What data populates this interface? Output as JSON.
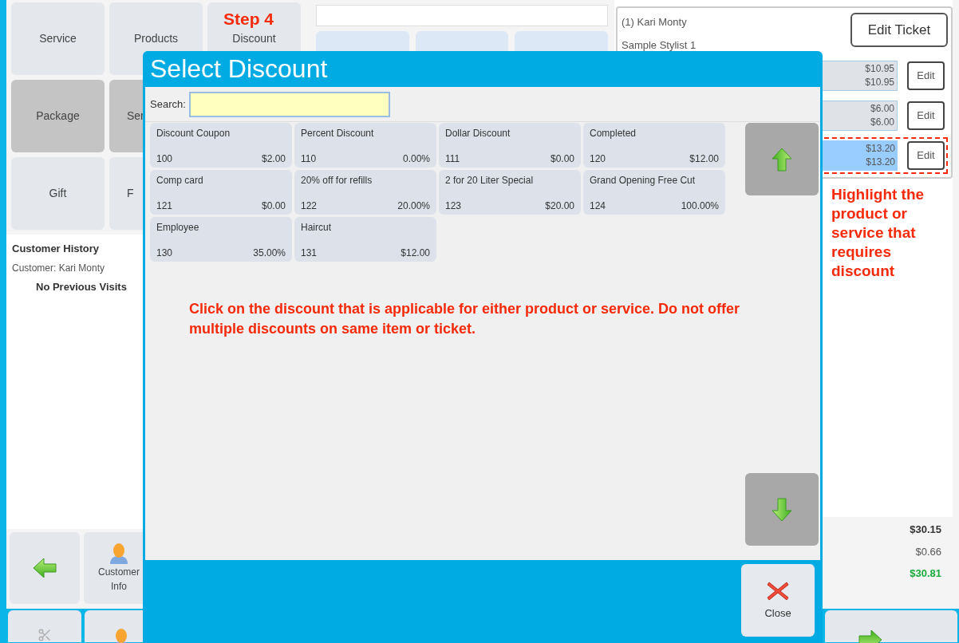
{
  "nav_tiles": [
    {
      "label": "Service",
      "selected": false
    },
    {
      "label": "Products",
      "selected": false
    },
    {
      "label": "Discount",
      "selected": false,
      "annotation": "Step 4"
    },
    {
      "label": "Package",
      "selected": true
    },
    {
      "label": "Ser",
      "selected": true
    },
    {
      "label": "Gift",
      "selected": false
    },
    {
      "label": "F",
      "selected": false
    }
  ],
  "customer_history": {
    "title": "Customer History",
    "customer": "Customer: Kari Monty",
    "visits": "No Previous Visits"
  },
  "customer_info_button": "Customer Info",
  "ticket": {
    "customer": "(1) Kari Monty",
    "stylist": "Sample Stylist 1",
    "edit_ticket": "Edit Ticket",
    "items": [
      {
        "price": "$10.95",
        "total": "$10.95",
        "edit": "Edit",
        "selected": false
      },
      {
        "price": "$6.00",
        "total": "$6.00",
        "edit": "Edit",
        "selected": false
      },
      {
        "price": "$13.20",
        "total": "$13.20",
        "edit": "Edit",
        "selected": true
      }
    ]
  },
  "annotation": "Highlight the product or service that requires discount",
  "totals": [
    {
      "kind": "subtotal",
      "value": "$30.15"
    },
    {
      "kind": "tax",
      "value": "$0.66"
    },
    {
      "kind": "total",
      "value": "$30.81"
    }
  ],
  "dialog": {
    "title": "Select Discount",
    "search_label": "Search:",
    "discounts": [
      {
        "name": "Discount Coupon",
        "code": "100",
        "amount": "$2.00"
      },
      {
        "name": "Percent Discount",
        "code": "110",
        "amount": "0.00%"
      },
      {
        "name": "Dollar Discount",
        "code": "111",
        "amount": "$0.00"
      },
      {
        "name": "Completed",
        "code": "120",
        "amount": "$12.00"
      },
      {
        "name": "Comp card",
        "code": "121",
        "amount": "$0.00"
      },
      {
        "name": "20% off for refills",
        "code": "122",
        "amount": "20.00%"
      },
      {
        "name": "2 for 20 Liter Special",
        "code": "123",
        "amount": "$20.00"
      },
      {
        "name": "Grand Opening Free Cut",
        "code": "124",
        "amount": "100.00%"
      },
      {
        "name": "Employee",
        "code": "130",
        "amount": "35.00%"
      },
      {
        "name": "Haircut",
        "code": "131",
        "amount": "$12.00"
      }
    ],
    "instruction": "Click on the discount that is applicable for either product or service.  Do not offer multiple discounts on same item or ticket.",
    "close": "Close"
  }
}
